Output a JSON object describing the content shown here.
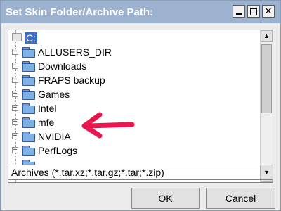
{
  "window": {
    "title": "Set Skin Folder/Archive Path:"
  },
  "tree": {
    "root": {
      "label": "C:"
    },
    "items": [
      {
        "label": "ALLUSERS_DIR",
        "expander": "+"
      },
      {
        "label": "Downloads",
        "expander": "+"
      },
      {
        "label": "FRAPS backup",
        "expander": "+"
      },
      {
        "label": "Games",
        "expander": "+"
      },
      {
        "label": "Intel",
        "expander": "+"
      },
      {
        "label": "mfe",
        "expander": "+"
      },
      {
        "label": "NVIDIA",
        "expander": "+"
      },
      {
        "label": "PerfLogs",
        "expander": "+"
      }
    ]
  },
  "filter": {
    "value": "Archives (*.tar.xz;*.tar.gz;*.tar;*.zip)"
  },
  "buttons": {
    "ok": "OK",
    "cancel": "Cancel"
  },
  "colors": {
    "titlebar": "#9db2cf",
    "selection": "#3b6fc6",
    "annotation_arrow": "#e8174f",
    "folder": "#7fb0e6"
  },
  "glyphs": {
    "scroll_up": "▲",
    "scroll_down": "▼",
    "combo_arrow": "▼",
    "close": "✕"
  }
}
